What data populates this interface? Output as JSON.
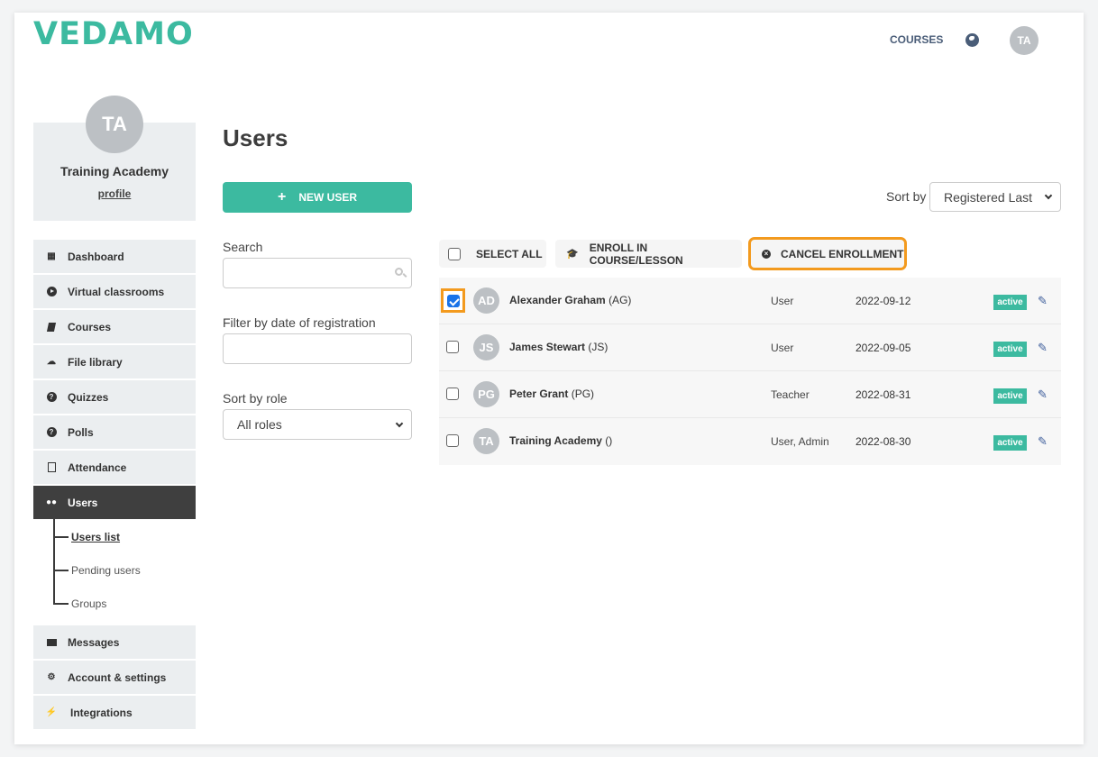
{
  "header": {
    "logo": "VEDAMO",
    "nav_courses": "COURSES",
    "language_icon": "globe-icon",
    "avatar_initials": "TA"
  },
  "profile": {
    "initials": "TA",
    "name": "Training Academy",
    "link": "profile"
  },
  "sidebar": {
    "items": [
      {
        "label": "Dashboard",
        "icon": "dashboard-icon",
        "glyph": "▦"
      },
      {
        "label": "Virtual classrooms",
        "icon": "play-circle-icon",
        "glyph": "▶"
      },
      {
        "label": "Courses",
        "icon": "book-icon",
        "glyph": "▰"
      },
      {
        "label": "File library",
        "icon": "cloud-upload-icon",
        "glyph": "☁"
      },
      {
        "label": "Quizzes",
        "icon": "question-circle-icon",
        "glyph": "?"
      },
      {
        "label": "Polls",
        "icon": "question-circle-icon",
        "glyph": "?"
      },
      {
        "label": "Attendance",
        "icon": "document-icon",
        "glyph": "▤"
      },
      {
        "label": "Users",
        "icon": "users-icon",
        "glyph": "👥"
      },
      {
        "label": "Messages",
        "icon": "envelope-icon",
        "glyph": "✉"
      },
      {
        "label": "Account & settings",
        "icon": "gear-icon",
        "glyph": "⚙"
      },
      {
        "label": "Integrations",
        "icon": "plug-icon",
        "glyph": "⚡"
      }
    ],
    "active": "Users",
    "users_submenu": [
      {
        "label": "Users list",
        "current": true
      },
      {
        "label": "Pending users",
        "current": false
      },
      {
        "label": "Groups",
        "current": false
      }
    ]
  },
  "main": {
    "title": "Users",
    "new_user_label": "NEW USER",
    "filters": {
      "search_label": "Search",
      "search_value": "",
      "date_label": "Filter by date of registration",
      "date_value": "",
      "role_label": "Sort by role",
      "role_selected": "All roles"
    },
    "sort": {
      "label": "Sort by",
      "selected": "Registered Last"
    },
    "toolbar": {
      "select_all": "SELECT ALL",
      "enroll": "ENROLL IN COURSE/LESSON",
      "cancel": "CANCEL ENROLLMENT"
    },
    "users": [
      {
        "initials": "AD",
        "name": "Alexander Graham",
        "short": "(AG)",
        "role": "User",
        "date": "2022-09-12",
        "status": "active",
        "checked": true
      },
      {
        "initials": "JS",
        "name": "James Stewart",
        "short": "(JS)",
        "role": "User",
        "date": "2022-09-05",
        "status": "active",
        "checked": false
      },
      {
        "initials": "PG",
        "name": "Peter Grant",
        "short": "(PG)",
        "role": "Teacher",
        "date": "2022-08-31",
        "status": "active",
        "checked": false
      },
      {
        "initials": "TA",
        "name": "Training Academy",
        "short": "()",
        "role": "User, Admin",
        "date": "2022-08-30",
        "status": "active",
        "checked": false
      }
    ]
  },
  "colors": {
    "brand": "#3cbaa0",
    "highlight": "#f39a1e",
    "nav_text": "#4a5d78",
    "active_menu": "#3f3f3f"
  }
}
